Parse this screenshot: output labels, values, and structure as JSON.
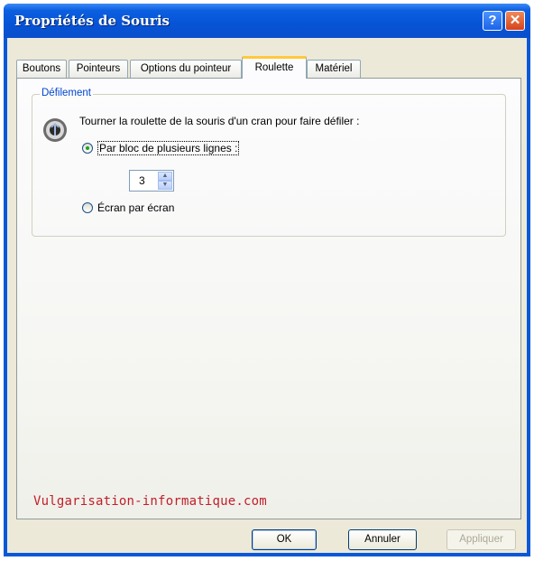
{
  "window": {
    "title": "Propriétés de Souris",
    "help_label": "?",
    "close_label": "✕"
  },
  "tabs": [
    {
      "label": "Boutons"
    },
    {
      "label": "Pointeurs"
    },
    {
      "label": "Options du pointeur"
    },
    {
      "label": "Roulette",
      "active": true
    },
    {
      "label": "Matériel"
    }
  ],
  "group": {
    "label": "Défilement",
    "icon": "mouse-wheel-icon",
    "description": "Tourner la roulette de la souris d'un cran pour faire défiler :",
    "option_lines": {
      "label": "Par bloc de plusieurs lignes :",
      "checked": true
    },
    "lines_value": "3",
    "option_screen": {
      "label": "Écran par écran",
      "checked": false
    }
  },
  "watermark": "Vulgarisation-informatique.com",
  "buttons": {
    "ok": "OK",
    "cancel": "Annuler",
    "apply": "Appliquer"
  },
  "colors": {
    "titlebar": "#0a58d8",
    "group_label": "#0046d5",
    "watermark": "#c0202a",
    "active_tab_accent": "#ffc83c"
  }
}
